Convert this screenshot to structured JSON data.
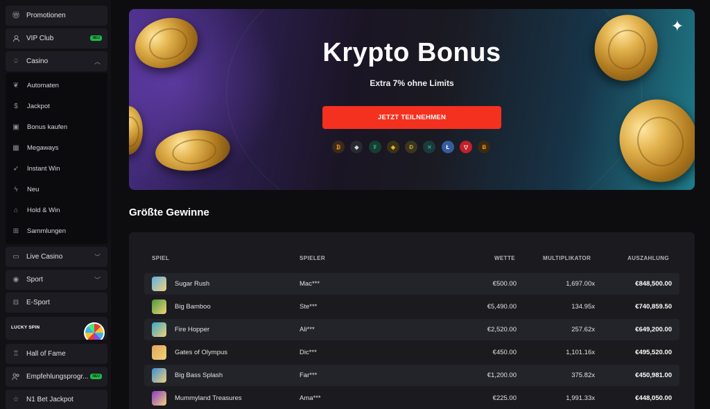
{
  "sidebar": {
    "promotionen": "Promotionen",
    "vip_club": "VIP Club",
    "vip_badge": "NEU",
    "casino": "Casino",
    "casino_sub": [
      {
        "label": "Automaten",
        "icon": "cherries-icon"
      },
      {
        "label": "Jackpot",
        "icon": "money-bag-icon"
      },
      {
        "label": "Bonus kaufen",
        "icon": "gift-icon"
      },
      {
        "label": "Megaways",
        "icon": "grid-icon"
      },
      {
        "label": "Instant Win",
        "icon": "rocket-icon"
      },
      {
        "label": "Neu",
        "icon": "lightning-icon"
      },
      {
        "label": "Hold & Win",
        "icon": "hold-icon"
      },
      {
        "label": "Sammlungen",
        "icon": "collections-icon"
      }
    ],
    "live_casino": "Live Casino",
    "sport": "Sport",
    "esport": "E-Sport",
    "lucky_spin": "LUCKY SPIN",
    "hall_of_fame": "Hall of Fame",
    "empfehlung": "Empfehlungsprogr...",
    "empfehlung_badge": "NEU",
    "jackpot_bottom": "N1 Bet Jackpot"
  },
  "banner": {
    "title": "Krypto Bonus",
    "subtitle": "Extra 7% ohne Limits",
    "button": "JETZT TEILNEHMEN",
    "cryptos": [
      {
        "name": "bitcoin",
        "glyph": "₿",
        "color": "#3a2a1c",
        "fg": "#f7931a"
      },
      {
        "name": "ethereum",
        "glyph": "◆",
        "color": "#2a2a33",
        "fg": "#d6d6e0"
      },
      {
        "name": "tether",
        "glyph": "₮",
        "color": "#173d33",
        "fg": "#26a17b"
      },
      {
        "name": "binance",
        "glyph": "◈",
        "color": "#3a3217",
        "fg": "#f3ba2f"
      },
      {
        "name": "dogecoin",
        "glyph": "Ð",
        "color": "#3a3520",
        "fg": "#c2a633"
      },
      {
        "name": "ripple",
        "glyph": "✕",
        "color": "#1d3a3a",
        "fg": "#23a8a0"
      },
      {
        "name": "litecoin",
        "glyph": "Ł",
        "color": "#345d9d",
        "fg": "#ffffff"
      },
      {
        "name": "tron",
        "glyph": "▽",
        "color": "#c41f2a",
        "fg": "#ffffff"
      },
      {
        "name": "bitcoin-cash",
        "glyph": "Ƀ",
        "color": "#3a2a12",
        "fg": "#f7931a"
      }
    ]
  },
  "winners": {
    "title": "Größte Gewinne",
    "headers": {
      "game": "SPIEL",
      "player": "SPIELER",
      "bet": "WETTE",
      "mult": "MULTIPLIKATOR",
      "payout": "AUSZAHLUNG"
    },
    "rows": [
      {
        "game": "Sugar Rush",
        "player": "Mac***",
        "bet": "€500.00",
        "mult": "1,697.00x",
        "payout": "€848,500.00",
        "thumb": "#5fb0e6"
      },
      {
        "game": "Big Bamboo",
        "player": "Ste***",
        "bet": "€5,490.00",
        "mult": "134.95x",
        "payout": "€740,859.50",
        "thumb": "#4c9a3a"
      },
      {
        "game": "Fire Hopper",
        "player": "Ali***",
        "bet": "€2,520.00",
        "mult": "257.62x",
        "payout": "€649,200.00",
        "thumb": "#3aa6c8"
      },
      {
        "game": "Gates of Olympus",
        "player": "Dic***",
        "bet": "€450.00",
        "mult": "1,101.16x",
        "payout": "€495,520.00",
        "thumb": "#e0a65a"
      },
      {
        "game": "Big Bass Splash",
        "player": "Far***",
        "bet": "€1,200.00",
        "mult": "375.82x",
        "payout": "€450,981.00",
        "thumb": "#3a8fd8"
      },
      {
        "game": "Mummyland Treasures",
        "player": "Ama***",
        "bet": "€225.00",
        "mult": "1,991.33x",
        "payout": "€448,050.00",
        "thumb": "#8a3ac8"
      }
    ]
  }
}
